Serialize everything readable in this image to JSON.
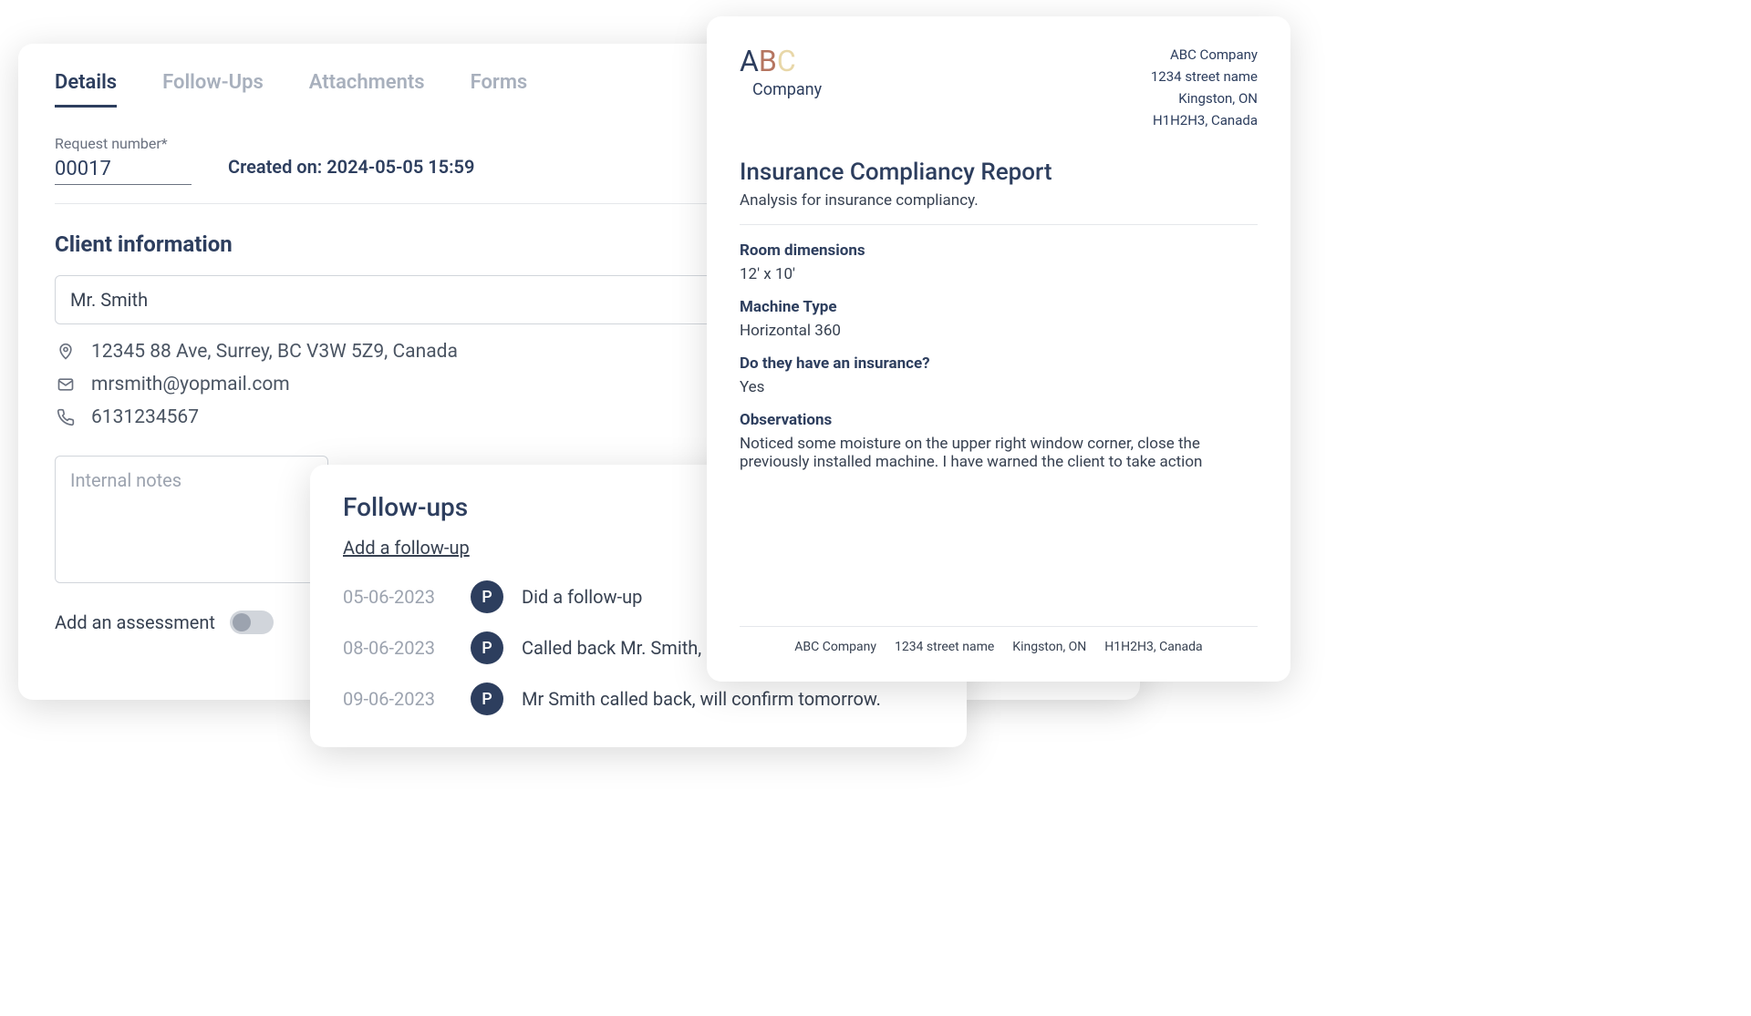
{
  "tabs": [
    "Details",
    "Follow-Ups",
    "Attachments",
    "Forms"
  ],
  "request": {
    "number_label": "Request number*",
    "number": "00017",
    "created_label": "Created on: 2024-05-05 15:59"
  },
  "client": {
    "section_title": "Client information",
    "name": "Mr. Smith",
    "address": "12345 88 Ave, Surrey, BC V3W 5Z9, Canada",
    "email": "mrsmith@yopmail.com",
    "phone": "6131234567"
  },
  "notes_placeholder": "Internal notes",
  "assessment": {
    "label": "Add an assessment"
  },
  "followups": {
    "title": "Follow-ups",
    "add_label": "Add a follow-up",
    "items": [
      {
        "date": "05-06-2023",
        "avatar": "P",
        "text": "Did a follow-up"
      },
      {
        "date": "08-06-2023",
        "avatar": "P",
        "text": "Called back Mr. Smith,"
      },
      {
        "date": "09-06-2023",
        "avatar": "P",
        "text": "Mr Smith called back, will confirm tomorrow."
      }
    ]
  },
  "report": {
    "logo": {
      "a": "A",
      "b": "B",
      "c": "C",
      "company": "Company"
    },
    "company_info": [
      "ABC Company",
      "1234 street name",
      "Kingston, ON",
      "H1H2H3, Canada"
    ],
    "title": "Insurance Compliancy Report",
    "subtitle": "Analysis for insurance compliancy.",
    "fields": [
      {
        "label": "Room dimensions",
        "value": "12' x 10'"
      },
      {
        "label": "Machine Type",
        "value": "Horizontal 360"
      },
      {
        "label": "Do they have an insurance?",
        "value": "Yes"
      },
      {
        "label": "Observations",
        "value": "Noticed some moisture on the upper right window corner, close the previously installed machine. I have warned the client to take action"
      }
    ],
    "footer": [
      "ABC Company",
      "1234 street name",
      "Kingston, ON",
      "H1H2H3, Canada"
    ]
  }
}
